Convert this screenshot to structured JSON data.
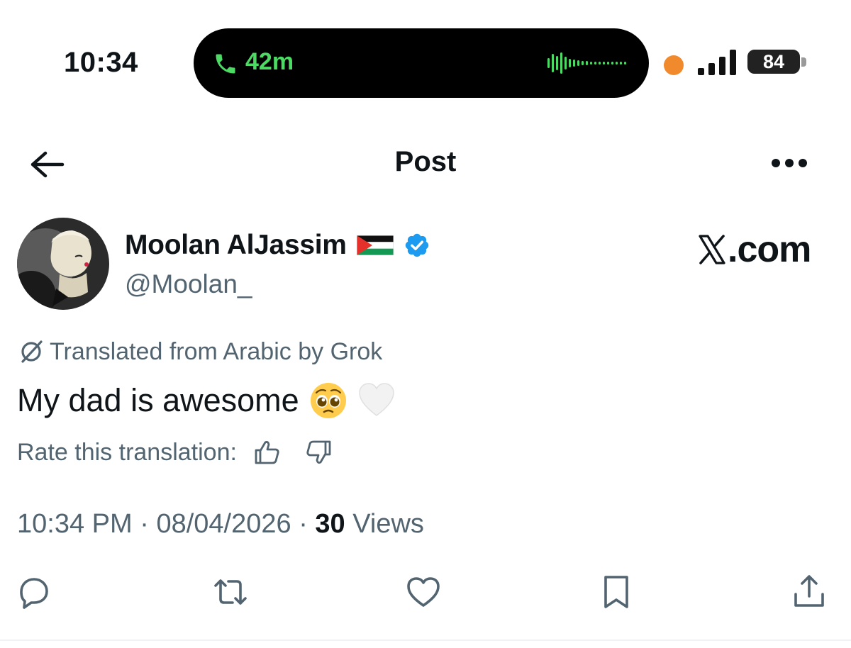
{
  "status_bar": {
    "time": "10:34",
    "call_duration": "42m",
    "battery_level": "84",
    "call_color": "#4cd964",
    "recording_dot_color": "#f08a2c"
  },
  "nav": {
    "title": "Post",
    "back_icon": "arrow-left-icon",
    "more_icon": "more-dots-icon"
  },
  "author": {
    "display_name": "Moolan AlJassim",
    "handle": "@Moolan_",
    "flag_icon": "palestine-flag",
    "verified_icon": "verified-badge",
    "verified_color": "#1d9bf0"
  },
  "watermark": {
    "text": ".com",
    "logo_icon": "x-logo"
  },
  "translation": {
    "note": "Translated from Arabic by Grok",
    "rate_label": "Rate this translation:"
  },
  "post": {
    "text": "My dad is awesome",
    "emojis": [
      "pleading-face",
      "white-heart"
    ]
  },
  "meta": {
    "time": "10:34 PM",
    "separator": "·",
    "date": "08/04/2026",
    "views_count": "30",
    "views_label": "Views"
  },
  "actions": [
    "reply-icon",
    "repost-icon",
    "like-icon",
    "bookmark-icon",
    "share-icon"
  ]
}
